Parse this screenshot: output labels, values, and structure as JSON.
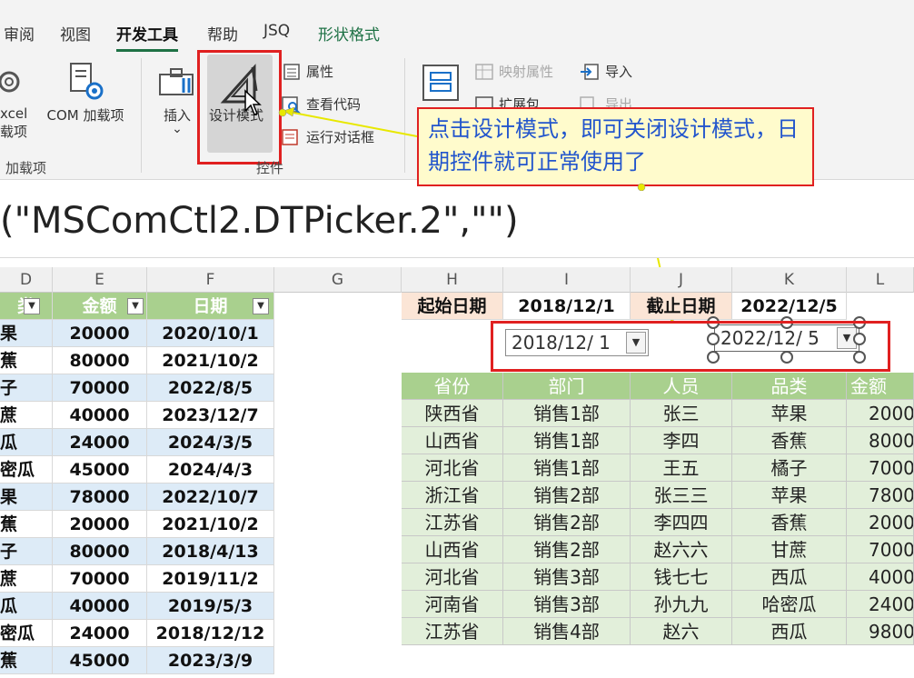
{
  "ribbon_tabs": [
    {
      "label": "审阅"
    },
    {
      "label": "视图"
    },
    {
      "label": "开发工具"
    },
    {
      "label": "帮助"
    },
    {
      "label": "JSQ"
    },
    {
      "label": "形状格式"
    }
  ],
  "ribbon": {
    "excel_addin_line1": "xcel",
    "excel_addin_line2": "载项",
    "com_addin": "COM 加载项",
    "addins_group": "加载项",
    "insert": "插入",
    "insert_arrow": "⌄",
    "design_mode": "设计模式",
    "properties": "属性",
    "view_code": "查看代码",
    "run_dialog": "运行对话框",
    "controls_group": "控件",
    "map_properties": "映射属性",
    "import": "导入",
    "expansion_pack": "扩展包",
    "export": "导出"
  },
  "callout": {
    "text": "点击设计模式，即可关闭设计模式，日期控件就可正常使用了"
  },
  "formula_bar": {
    "text": "(\"MSComCtl2.DTPicker.2\",\"\")"
  },
  "columns": [
    "D",
    "E",
    "F",
    "G",
    "H",
    "I",
    "J",
    "K",
    "L"
  ],
  "left_table": {
    "headers": [
      "类",
      "金额",
      "日期"
    ],
    "rows": [
      [
        "果",
        "20000",
        "2020/10/1"
      ],
      [
        "蕉",
        "80000",
        "2021/10/2"
      ],
      [
        "子",
        "70000",
        "2022/8/5"
      ],
      [
        "蔗",
        "40000",
        "2023/12/7"
      ],
      [
        "瓜",
        "24000",
        "2024/3/5"
      ],
      [
        "密瓜",
        "45000",
        "2024/4/3"
      ],
      [
        "果",
        "78000",
        "2022/10/7"
      ],
      [
        "蕉",
        "20000",
        "2021/10/2"
      ],
      [
        "子",
        "80000",
        "2018/4/13"
      ],
      [
        "蔗",
        "70000",
        "2019/11/2"
      ],
      [
        "瓜",
        "40000",
        "2019/5/3"
      ],
      [
        "密瓜",
        "24000",
        "2018/12/12"
      ],
      [
        "蕉",
        "45000",
        "2023/3/9"
      ]
    ]
  },
  "date_range": {
    "start_label": "起始日期",
    "start_value": "2018/12/1",
    "end_label": "截止日期",
    "end_value": "2022/12/5",
    "start_picker": "2018/12/ 1",
    "end_picker": "2022/12/ 5"
  },
  "right_table": {
    "headers": [
      "省份",
      "部门",
      "人员",
      "品类",
      "金额"
    ],
    "rows": [
      [
        "陕西省",
        "销售1部",
        "张三",
        "苹果",
        "2000"
      ],
      [
        "山西省",
        "销售1部",
        "李四",
        "香蕉",
        "8000"
      ],
      [
        "河北省",
        "销售1部",
        "王五",
        "橘子",
        "7000"
      ],
      [
        "浙江省",
        "销售2部",
        "张三三",
        "苹果",
        "7800"
      ],
      [
        "江苏省",
        "销售2部",
        "李四四",
        "香蕉",
        "2000"
      ],
      [
        "山西省",
        "销售2部",
        "赵六六",
        "甘蔗",
        "7000"
      ],
      [
        "河北省",
        "销售3部",
        "钱七七",
        "西瓜",
        "4000"
      ],
      [
        "河南省",
        "销售3部",
        "孙九九",
        "哈密瓜",
        "2400"
      ],
      [
        "江苏省",
        "销售4部",
        "赵六",
        "西瓜",
        "9800"
      ]
    ]
  },
  "colors": {
    "accent_red": "#e02020",
    "header_green": "#a9d08e",
    "row_blue": "#ddebf7",
    "data_green": "#e2efda",
    "callout_text": "#2255cc"
  }
}
